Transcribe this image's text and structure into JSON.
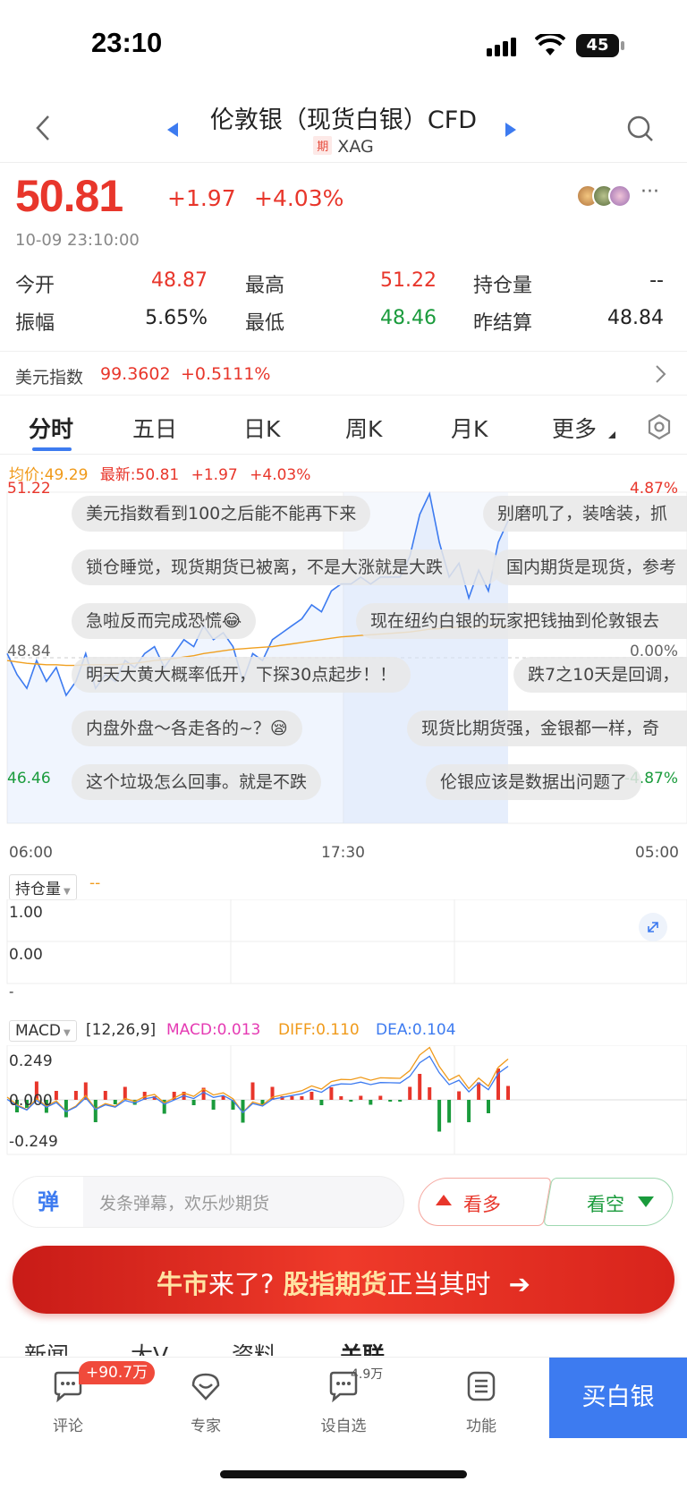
{
  "status_bar": {
    "time": "23:10",
    "battery": "45"
  },
  "nav": {
    "title": "伦敦银（现货白银）CFD",
    "badge": "期",
    "symbol": "XAG"
  },
  "quote": {
    "price": "50.81",
    "change": "+1.97",
    "change_pct": "+4.03%",
    "timestamp": "10-09 23:10:00"
  },
  "stats": [
    {
      "label": "今开",
      "value": "48.87",
      "color": "red"
    },
    {
      "label": "最高",
      "value": "51.22",
      "color": "red"
    },
    {
      "label": "持仓量",
      "value": "--",
      "color": "black"
    },
    {
      "label": "振幅",
      "value": "5.65%",
      "color": "black"
    },
    {
      "label": "最低",
      "value": "48.46",
      "color": "green"
    },
    {
      "label": "昨结算",
      "value": "48.84",
      "color": "black"
    }
  ],
  "usd_index": {
    "label": "美元指数",
    "value": "99.3602",
    "change": "+0.5111%"
  },
  "tabs": [
    "分时",
    "五日",
    "日K",
    "周K",
    "月K",
    "更多"
  ],
  "active_tab": "分时",
  "intraday": {
    "avg_label": "均价:49.29",
    "latest_label": "最新:50.81",
    "change": "+1.97",
    "change_pct": "+4.03%"
  },
  "chart_data": {
    "type": "line",
    "title": "",
    "y_high": "51.22",
    "y_prev": "48.84",
    "y_low": "46.46",
    "pct_high": "4.87%",
    "pct_prev": "0.00%",
    "pct_low": "-4.87%",
    "x_ticks": [
      "06:00",
      "17:30",
      "05:00"
    ],
    "ylim": [
      46.46,
      51.22
    ],
    "series": [
      {
        "values": [
          48.9,
          48.6,
          48.4,
          48.8,
          48.5,
          48.7,
          48.3,
          48.5,
          48.9,
          48.4,
          48.6,
          48.5,
          48.8,
          48.7,
          48.9,
          49.0,
          48.7,
          48.9,
          49.1,
          49.0,
          49.3,
          49.1,
          49.2,
          49.0,
          48.5,
          48.9,
          48.8,
          49.1,
          49.2,
          49.3,
          49.4,
          49.6,
          49.5,
          49.8,
          49.9,
          49.9,
          50.0,
          49.9,
          50.0,
          50.0,
          50.0,
          50.3,
          50.9,
          51.2,
          50.5,
          50.0,
          50.2,
          49.7,
          50.1,
          49.8,
          50.5,
          50.81
        ]
      },
      {
        "values": [
          48.8,
          48.78,
          48.76,
          48.75,
          48.74,
          48.74,
          48.73,
          48.73,
          48.74,
          48.74,
          48.74,
          48.74,
          48.75,
          48.76,
          48.78,
          48.8,
          48.81,
          48.83,
          48.85,
          48.87,
          48.9,
          48.92,
          48.94,
          48.96,
          48.97,
          48.98,
          48.99,
          49.0,
          49.02,
          49.04,
          49.06,
          49.08,
          49.1,
          49.12,
          49.14,
          49.15,
          49.16,
          49.17,
          49.18,
          49.19,
          49.2,
          49.21,
          49.23,
          49.25,
          49.26,
          49.27,
          49.28,
          49.28,
          49.29,
          49.29,
          49.29,
          49.29
        ]
      }
    ]
  },
  "danmu": [
    "美元指数看到100之后能不能再下来",
    "别磨叽了，装啥装，抓",
    "锁仓睡觉，现货期货已被离，不是大涨就是大跌",
    "国内期货是现货，参考",
    "急啦反而完成恐慌😂",
    "现在纽约白银的玩家把钱抽到伦敦银去",
    "明天大黄大概率低开，下探30点起步！！",
    "跌7之10天是回调，",
    "内盘外盘～各走各的~？😪",
    "现货比期货强，金银都一样，奇",
    "这个垃圾怎么回事。就是不跌",
    "伦银应该是数据出问题了"
  ],
  "open_interest": {
    "label": "持仓量",
    "value": "--",
    "ticks": [
      "1.00",
      "0.00",
      "-"
    ]
  },
  "macd": {
    "label": "MACD",
    "params": "[12,26,9]",
    "macd": "MACD:0.013",
    "diff": "DIFF:0.110",
    "dea": "DEA:0.104",
    "ticks": [
      "0.249",
      "0.000",
      "-0.249"
    ]
  },
  "danmu_input": {
    "icon_text": "弹",
    "placeholder": "发条弹幕，欢乐炒期货"
  },
  "bull_label": "看多",
  "bear_label": "看空",
  "banner": {
    "part1": "牛市",
    "part2": "来了?",
    "part3": "股指期货",
    "part4": "正当其时"
  },
  "sub_tabs": [
    "新闻",
    "大V",
    "资料",
    "关联"
  ],
  "bottom_nav": [
    {
      "label": "评论",
      "badge": "+90.7万"
    },
    {
      "label": "专家"
    },
    {
      "label": "设自选",
      "badge": "4.9万"
    },
    {
      "label": "功能"
    }
  ],
  "buy_label": "买白银"
}
